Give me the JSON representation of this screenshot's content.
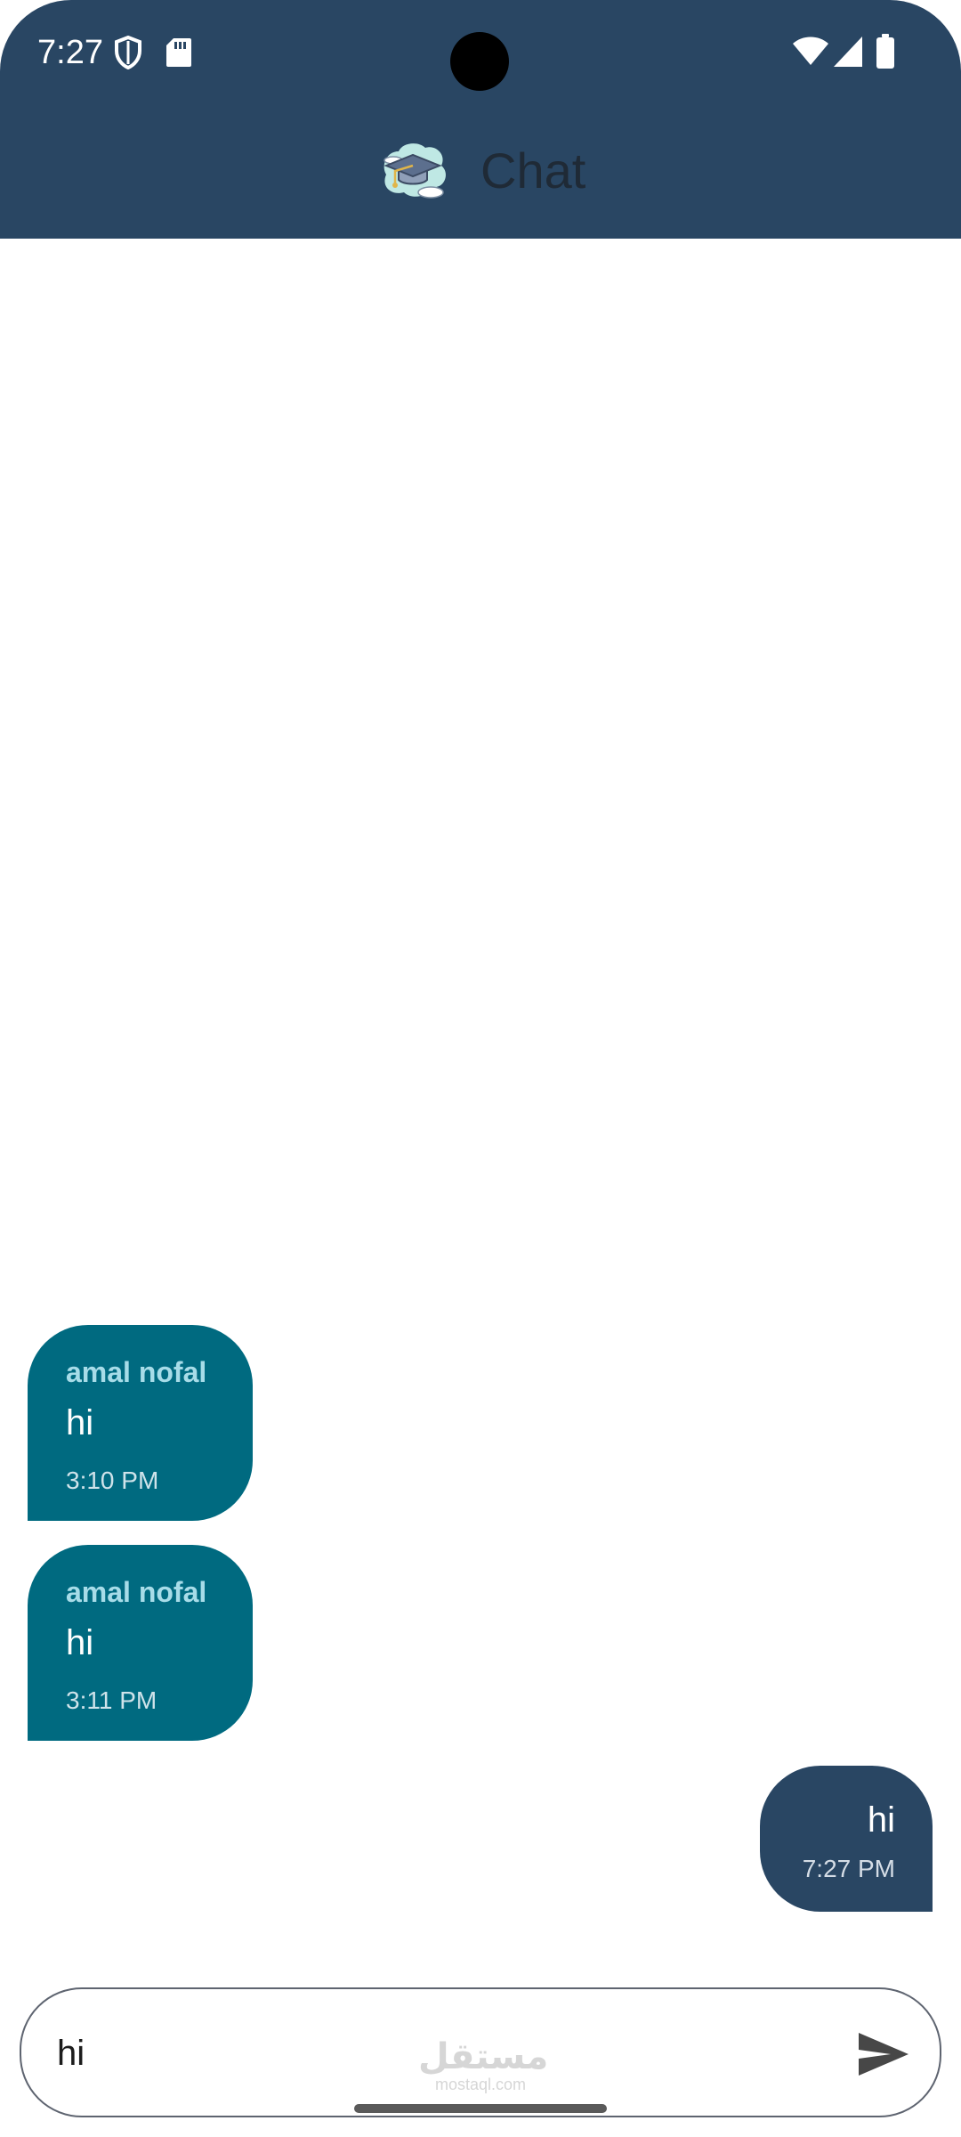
{
  "status_bar": {
    "time": "7:27",
    "icons": [
      "shield-icon",
      "sd-card-icon",
      "wifi-icon",
      "cell-signal-icon",
      "battery-icon"
    ]
  },
  "app_bar": {
    "title": "Chat",
    "logo_icon": "graduation-cap-icon"
  },
  "messages": [
    {
      "direction": "incoming",
      "sender": "amal nofal",
      "text": "hi",
      "time": "3:10 PM"
    },
    {
      "direction": "incoming",
      "sender": "amal nofal",
      "text": "hi",
      "time": "3:11 PM"
    },
    {
      "direction": "outgoing",
      "text": "hi",
      "time": "7:27 PM"
    }
  ],
  "composer": {
    "value": "hi",
    "send_icon": "send-icon"
  },
  "watermark": {
    "arabic": "مستقل",
    "latin": "mostaql.com"
  },
  "colors": {
    "header": "#294663",
    "incoming_bubble": "#006a80",
    "outgoing_bubble": "#294663",
    "sender_name": "#a7dce8"
  }
}
